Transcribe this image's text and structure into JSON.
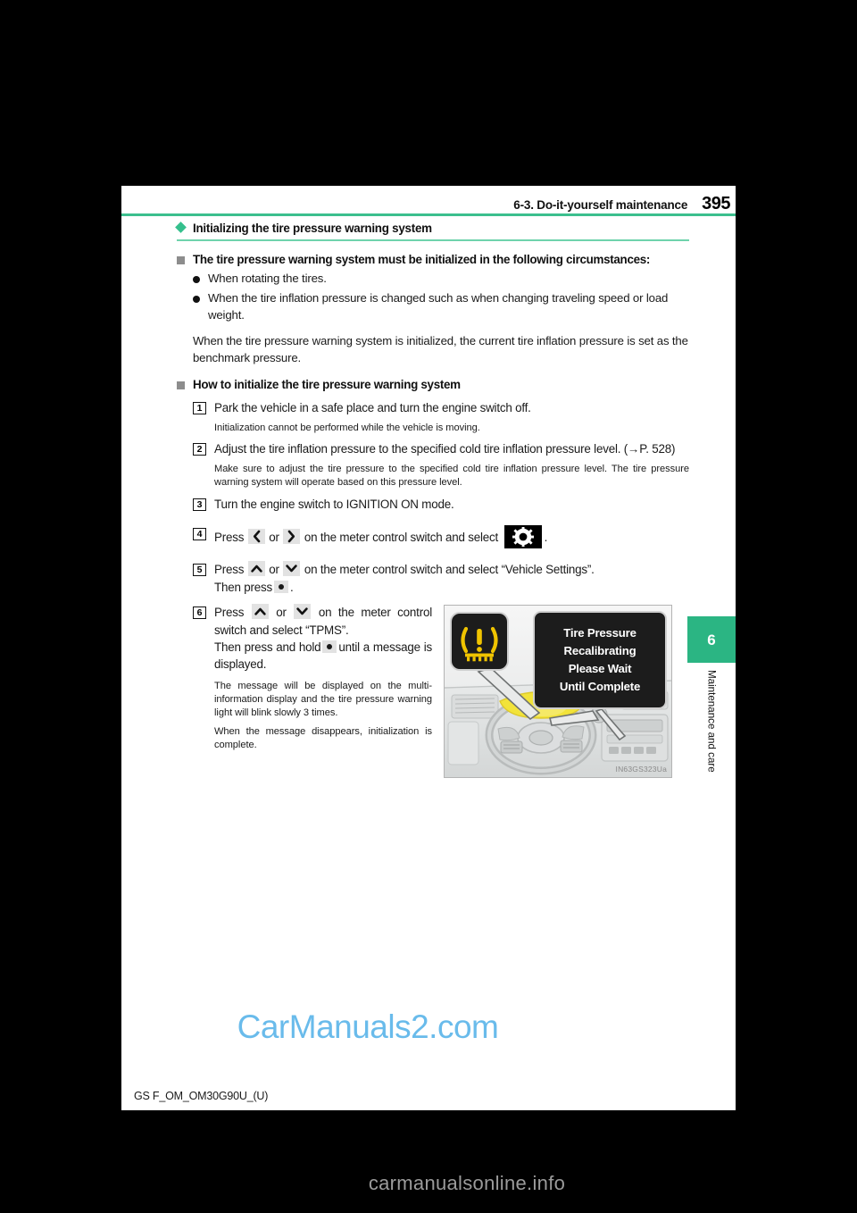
{
  "page": {
    "header_title": "6-3. Do-it-yourself maintenance",
    "page_number": "395",
    "footer_code": "GS F_OM_OM30G90U_(U)"
  },
  "side_tab": {
    "number": "6",
    "label": "Maintenance and care",
    "color": "#2bb583"
  },
  "section": {
    "diamond_title": "Initializing the tire pressure warning system",
    "diamond_color": "#35c08d"
  },
  "subsection_1": {
    "title": "The tire pressure warning system must be initialized in the following circumstances:",
    "bullets": [
      "When rotating the tires.",
      "When the tire inflation pressure is changed such as when changing traveling speed or load weight."
    ],
    "paragraph": "When the tire pressure warning system is initialized, the current tire inflation pressure is set as the benchmark pressure."
  },
  "subsection_2": {
    "title": "How to initialize the tire pressure warning system",
    "steps": [
      {
        "num": "1",
        "text": "Park the vehicle in a safe place and turn the engine switch off.",
        "note": "Initialization cannot be performed while the vehicle is moving."
      },
      {
        "num": "2",
        "text_a": "Adjust the tire inflation pressure to the specified cold tire inflation pressure level. (",
        "ref": "→P. 528",
        "text_b": ")",
        "note": "Make sure to adjust the tire pressure to the specified cold tire inflation pressure level. The tire pressure warning system will operate based on this pressure level."
      },
      {
        "num": "3",
        "text": "Turn the engine switch to IGNITION ON mode."
      },
      {
        "num": "4",
        "t1": "Press",
        "icon_1": "chevron-left-icon",
        "t2": "or",
        "icon_2": "chevron-right-icon",
        "t3": "on the meter control switch and select",
        "icon_3": "gear-icon",
        "t4": "."
      },
      {
        "num": "5",
        "t1": "Press",
        "icon_1": "chevron-up-icon",
        "t2": "or",
        "icon_2": "chevron-down-icon",
        "t3": "on the meter control switch and select “Vehicle Settings”.",
        "t4": "Then press",
        "icon_3": "enter-dot-icon",
        "t5": "."
      },
      {
        "num": "6",
        "t1": "Press",
        "icon_1": "chevron-up-icon",
        "t2": "or",
        "icon_2": "chevron-down-icon",
        "t3": "on the meter control switch and select “TPMS”.",
        "t4": "Then press and hold",
        "icon_3": "enter-dot-icon",
        "t5": "until a message is displayed.",
        "note_1": "The message will be displayed on the multi-information display and the tire pressure warning light will blink slowly 3 times.",
        "note_2": "When the message disappears, initialization is complete."
      }
    ]
  },
  "figure": {
    "id_code": "IN63GS323Ua",
    "warning_icon": "tire-pressure-warning-icon",
    "warning_icon_color": "#f0c400",
    "message_lines": [
      "Tire Pressure",
      "Recalibrating",
      "Please Wait",
      "Until Complete"
    ]
  },
  "watermarks": {
    "center": "CarManuals2.com",
    "bottom": "carmanualsonline.info"
  }
}
